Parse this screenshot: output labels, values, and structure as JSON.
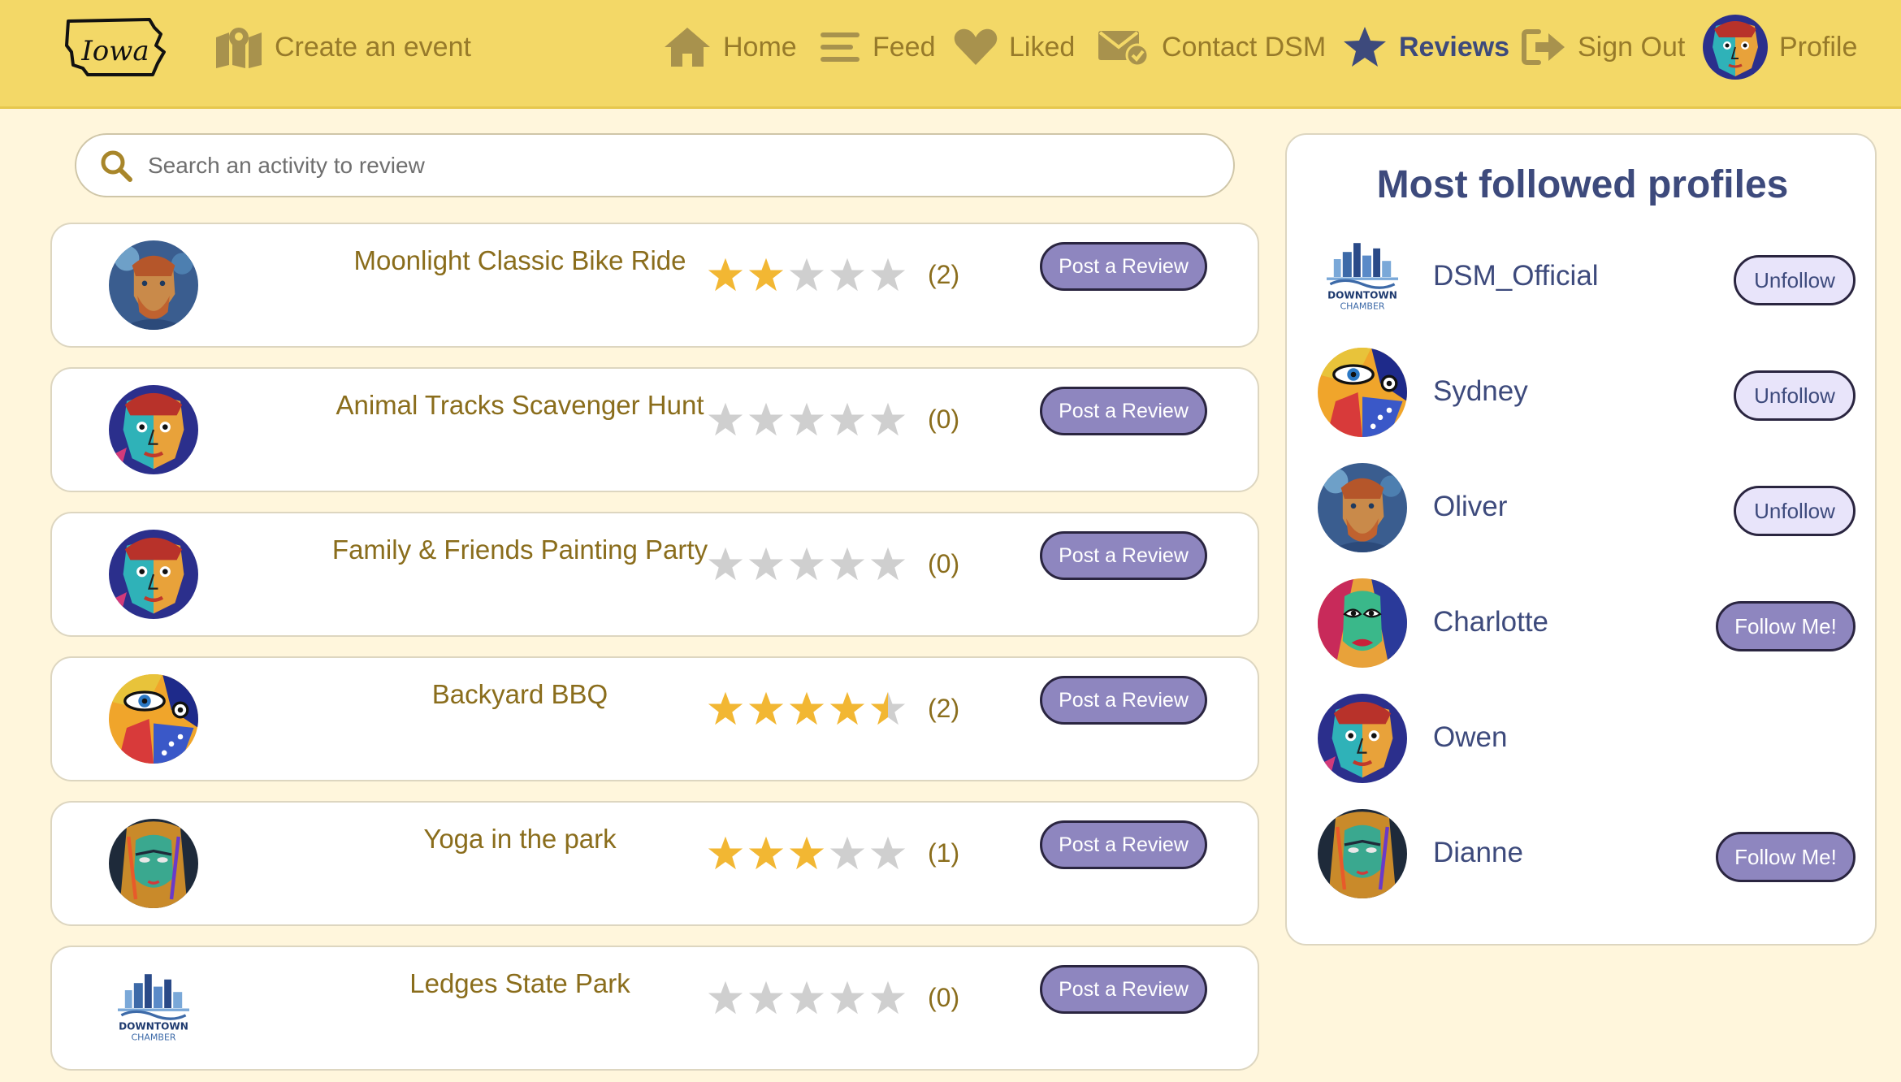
{
  "nav": {
    "logo_text": "Iowa",
    "create_event": "Create an event",
    "home": "Home",
    "feed": "Feed",
    "liked": "Liked",
    "contact": "Contact DSM",
    "reviews": "Reviews",
    "sign_out": "Sign Out",
    "profile": "Profile"
  },
  "search": {
    "placeholder": "Search an activity to review"
  },
  "activities": [
    {
      "title": "Moonlight Classic Bike Ride",
      "rating": 2,
      "count": "(2)",
      "button": "Post a Review",
      "avatar": "portrait-blue"
    },
    {
      "title": "Animal Tracks Scavenger Hunt",
      "rating": 0,
      "count": "(0)",
      "button": "Post a Review",
      "avatar": "portrait-cubist"
    },
    {
      "title": "Family & Friends Painting Party",
      "rating": 0,
      "count": "(0)",
      "button": "Post a Review",
      "avatar": "portrait-cubist"
    },
    {
      "title": "Backyard BBQ",
      "rating": 4.5,
      "count": "(2)",
      "button": "Post a Review",
      "avatar": "portrait-eye"
    },
    {
      "title": "Yoga in the park",
      "rating": 3,
      "count": "(1)",
      "button": "Post a Review",
      "avatar": "portrait-woman"
    },
    {
      "title": "Ledges State Park",
      "rating": 0,
      "count": "(0)",
      "button": "Post a Review",
      "avatar": "downtown-chamber"
    }
  ],
  "sidebar": {
    "title": "Most followed profiles",
    "profiles": [
      {
        "name": "DSM_Official",
        "button": "Unfollow",
        "following": true,
        "avatar": "downtown-chamber"
      },
      {
        "name": "Sydney",
        "button": "Unfollow",
        "following": true,
        "avatar": "portrait-eye"
      },
      {
        "name": "Oliver",
        "button": "Unfollow",
        "following": true,
        "avatar": "portrait-blue"
      },
      {
        "name": "Charlotte",
        "button": "Follow Me!",
        "following": false,
        "avatar": "portrait-face"
      },
      {
        "name": "Owen",
        "button": "",
        "following": null,
        "avatar": "portrait-cubist"
      },
      {
        "name": "Dianne",
        "button": "Follow Me!",
        "following": false,
        "avatar": "portrait-woman"
      }
    ]
  },
  "chamber_text": {
    "line1": "DOWNTOWN",
    "line2": "CHAMBER"
  },
  "colors": {
    "nav_bg": "#f3d867",
    "page_bg": "#fff6dc",
    "gold_text": "#8a6d1c",
    "navy": "#3d4a7c",
    "button_purple": "#8e86bf",
    "unfollow_bg": "#e8e4fa",
    "star_filled": "#f2b733",
    "star_empty": "#cfcfcf"
  }
}
